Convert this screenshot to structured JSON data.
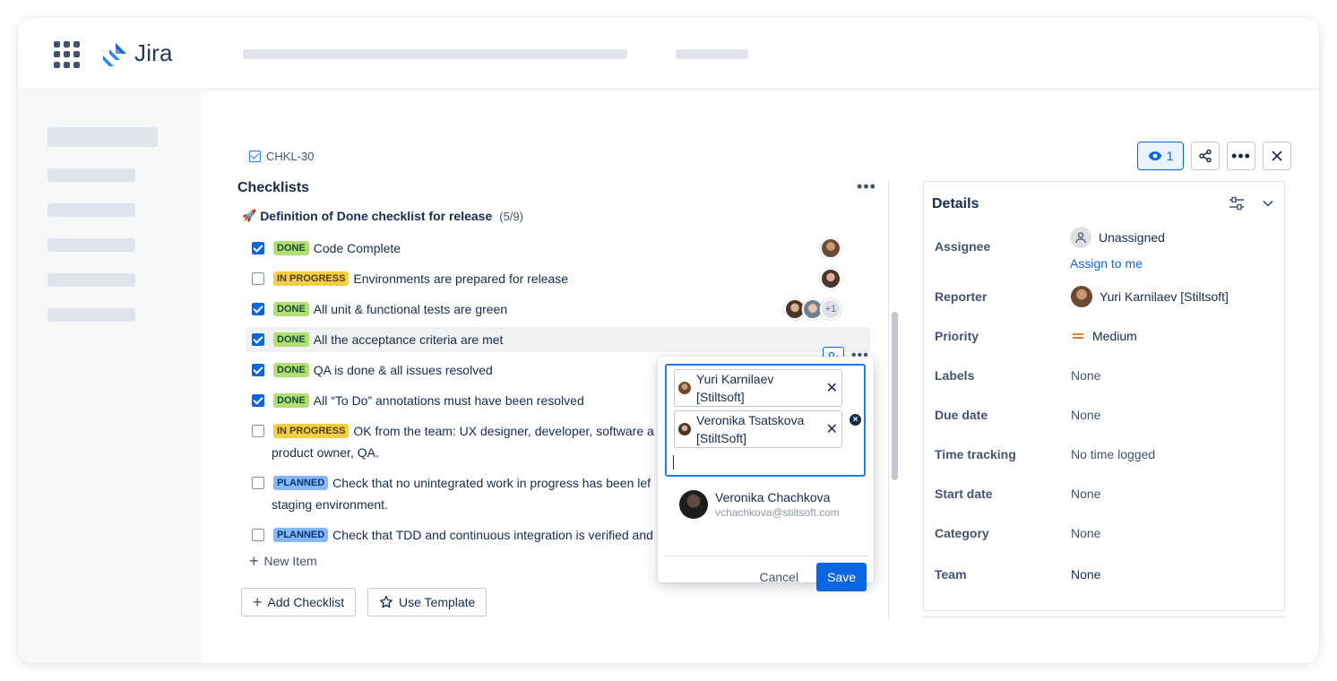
{
  "app": {
    "name": "Jira"
  },
  "issue": {
    "key": "CHKL-30"
  },
  "header": {
    "watch_count": "1"
  },
  "checklists": {
    "title": "Checklists",
    "checklist_title": "Definition of Done checklist for release",
    "checklist_emoji": "🚀",
    "progress": "(5/9)",
    "items": [
      {
        "checked": true,
        "status": "DONE",
        "text": "Code Complete"
      },
      {
        "checked": false,
        "status": "IN PROGRESS",
        "text": "Environments are prepared for release"
      },
      {
        "checked": true,
        "status": "DONE",
        "text": "All unit & functional tests are green",
        "extra_assignees": "+1"
      },
      {
        "checked": true,
        "status": "DONE",
        "text": "All the acceptance criteria are met"
      },
      {
        "checked": true,
        "status": "DONE",
        "text": "QA is done & all issues resolved"
      },
      {
        "checked": true,
        "status": "DONE",
        "text": "All “To Do” annotations must have been resolved"
      },
      {
        "checked": false,
        "status": "IN PROGRESS",
        "text": "OK from the team: UX designer, developer, software a",
        "text2": "product owner, QA."
      },
      {
        "checked": false,
        "status": "PLANNED",
        "text": "Check that no unintegrated work in progress has been lef",
        "text2": "staging environment."
      },
      {
        "checked": false,
        "status": "PLANNED",
        "text": "Check that TDD and continuous integration is verified and"
      }
    ],
    "new_item": "New Item",
    "add_checklist": "Add Checklist",
    "use_template": "Use Template"
  },
  "assignee_popup": {
    "selected": [
      {
        "line1": "Yuri Karnilaev",
        "line2": "[Stiltsoft]"
      },
      {
        "line1": "Veronika Tsatskova",
        "line2": "[StiltSoft]"
      }
    ],
    "suggestion": {
      "name": "Veronika Chachkova",
      "email": "vchachkova@stiltsoft.com"
    },
    "cancel": "Cancel",
    "save": "Save"
  },
  "details": {
    "title": "Details",
    "assign_to_me": "Assign to me",
    "rows": [
      {
        "label": "Assignee",
        "value": "Unassigned"
      },
      {
        "label": "Reporter",
        "value": "Yuri Karnilaev [Stiltsoft]"
      },
      {
        "label": "Priority",
        "value": "Medium"
      },
      {
        "label": "Labels",
        "value": "None"
      },
      {
        "label": "Due date",
        "value": "None"
      },
      {
        "label": "Time tracking",
        "value": "No time logged"
      },
      {
        "label": "Start date",
        "value": "None"
      },
      {
        "label": "Category",
        "value": "None"
      },
      {
        "label": "Team",
        "value": "None"
      }
    ]
  },
  "colors": {
    "brand": "#0c66e4",
    "done": "#b3df72",
    "in_progress": "#f5cd47",
    "planned": "#85b8ff",
    "priority_medium": "#e56910"
  }
}
